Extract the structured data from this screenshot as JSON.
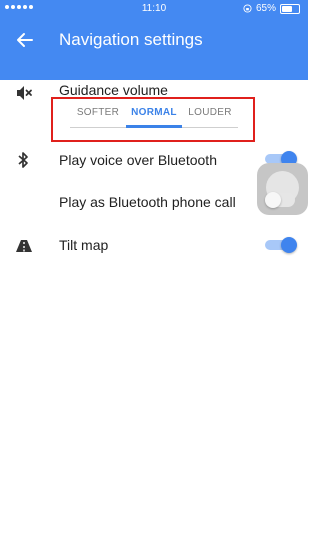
{
  "status_bar": {
    "time": "11:10",
    "battery": "65%",
    "battery_level": 0.65,
    "signal_icon": "signal-dots-icon",
    "lock_icon": "orientation-lock-icon"
  },
  "header": {
    "title": "Navigation settings",
    "back_icon": "arrow-back-icon",
    "background": "#4489f2"
  },
  "settings": {
    "guidance": {
      "label": "Guidance volume",
      "icon": "volume-off-icon",
      "options": [
        "SOFTER",
        "NORMAL",
        "LOUDER"
      ],
      "selected": "NORMAL",
      "accent": "#3b82e8",
      "highlight_color": "#e0201c"
    },
    "bluetooth_voice": {
      "label": "Play voice over Bluetooth",
      "icon": "bluetooth-icon",
      "on": true
    },
    "bluetooth_call": {
      "label": "Play as Bluetooth phone call"
    },
    "tilt_map": {
      "label": "Tilt map",
      "icon": "road-icon",
      "on": true
    }
  }
}
